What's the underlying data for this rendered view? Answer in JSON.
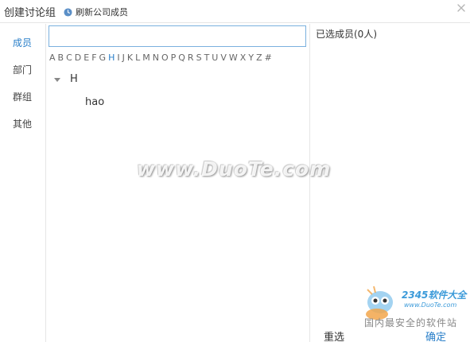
{
  "header": {
    "title": "创建讨论组",
    "refresh_label": "刷新公司成员",
    "close_glyph": "×"
  },
  "nav": {
    "items": [
      {
        "label": "成员",
        "active": true
      },
      {
        "label": "部门",
        "active": false
      },
      {
        "label": "群组",
        "active": false
      },
      {
        "label": "其他",
        "active": false
      }
    ]
  },
  "search": {
    "value": "",
    "placeholder": ""
  },
  "alphabet": {
    "letters": [
      "A",
      "B",
      "C",
      "D",
      "E",
      "F",
      "G",
      "H",
      "I",
      "J",
      "K",
      "L",
      "M",
      "N",
      "O",
      "P",
      "Q",
      "R",
      "S",
      "T",
      "U",
      "V",
      "W",
      "X",
      "Y",
      "Z",
      "#"
    ],
    "active": "H"
  },
  "groups": [
    {
      "label": "H",
      "members": [
        "hao"
      ]
    }
  ],
  "selected": {
    "title": "已选成员(0人)"
  },
  "buttons": {
    "reset": "重选",
    "confirm": "确定"
  },
  "watermark": {
    "center": "www.DuoTe.com",
    "logo_text": "2345软件大全",
    "logo_url": "www.DuoTe.com",
    "slogan": "国内最安全的软件站"
  },
  "colors": {
    "accent": "#2a7fc9",
    "border": "#e6e6e6",
    "input_border": "#7ab0de"
  }
}
